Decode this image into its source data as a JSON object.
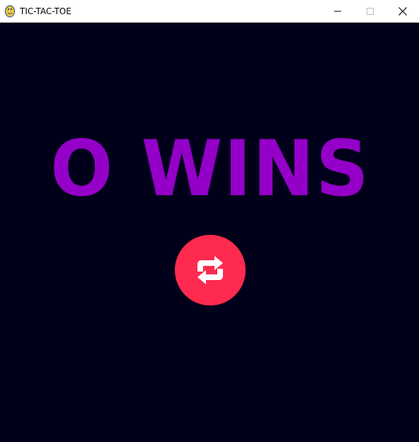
{
  "window": {
    "title": "TIC-TAC-TOE",
    "icon": "pygame-snake-icon",
    "controls": [
      "minimize-icon",
      "maximize-icon",
      "close-icon"
    ]
  },
  "game": {
    "result_text": "O WINS",
    "result_color": "#9400c8",
    "background_color": "#00001a",
    "restart_button": {
      "icon": "restart-icon",
      "color": "#ff2a4f"
    }
  }
}
